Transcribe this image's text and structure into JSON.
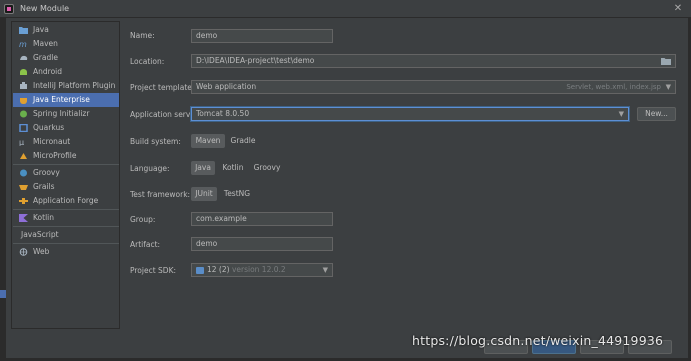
{
  "window": {
    "title": "New Module",
    "close_glyph": "✕"
  },
  "sidebar": {
    "group1": [
      {
        "label": "Java",
        "icon": "folder-icon",
        "color": "#6a9fd4"
      },
      {
        "label": "Maven",
        "icon": "maven-icon",
        "color": "#6a9fd4"
      },
      {
        "label": "Gradle",
        "icon": "gradle-icon",
        "color": "#a7b4c0"
      },
      {
        "label": "Android",
        "icon": "android-icon",
        "color": "#8bc34a"
      },
      {
        "label": "IntelliJ Platform Plugin",
        "icon": "plugin-icon",
        "color": "#a7b4c0"
      },
      {
        "label": "Java Enterprise",
        "icon": "java-enterprise-icon",
        "color": "#e0a030",
        "selected": true
      },
      {
        "label": "Spring Initializr",
        "icon": "spring-icon",
        "color": "#6ab04c"
      },
      {
        "label": "Quarkus",
        "icon": "quarkus-icon",
        "color": "#5d8fd4"
      },
      {
        "label": "Micronaut",
        "icon": "micronaut-icon",
        "color": "#a7b4c0"
      },
      {
        "label": "MicroProfile",
        "icon": "microprofile-icon",
        "color": "#e0a030"
      }
    ],
    "group2": [
      {
        "label": "Groovy",
        "icon": "groovy-icon",
        "color": "#4a90c2"
      },
      {
        "label": "Grails",
        "icon": "grails-icon",
        "color": "#e0a030"
      },
      {
        "label": "Application Forge",
        "icon": "forge-icon",
        "color": "#e0a030"
      }
    ],
    "group3": [
      {
        "label": "Kotlin",
        "icon": "kotlin-icon",
        "color": "#8e6fd8"
      }
    ],
    "group4": [
      {
        "label": "JavaScript",
        "icon": "",
        "color": ""
      }
    ],
    "group5": [
      {
        "label": "Web",
        "icon": "globe-icon",
        "color": "#a7b4c0"
      }
    ]
  },
  "form": {
    "name": {
      "label": "Name:",
      "value": "demo"
    },
    "location": {
      "label": "Location:",
      "value": "D:\\IDEA\\IDEA-project\\test\\demo",
      "browse_icon": "folder-browse-icon"
    },
    "template": {
      "label": "Project template:",
      "value": "Web application",
      "hint": "Servlet, web.xml, index.jsp"
    },
    "server": {
      "label": "Application server:",
      "value": "Tomcat 8.0.50",
      "new_button": "New..."
    },
    "build": {
      "label": "Build system:",
      "options": [
        "Maven",
        "Gradle"
      ],
      "selected": "Maven"
    },
    "language": {
      "label": "Language:",
      "options": [
        "Java",
        "Kotlin",
        "Groovy"
      ],
      "selected": "Java"
    },
    "test": {
      "label": "Test framework:",
      "options": [
        "JUnit",
        "TestNG"
      ],
      "selected": "JUnit"
    },
    "group": {
      "label": "Group:",
      "value": "com.example"
    },
    "artifact": {
      "label": "Artifact:",
      "value": "demo"
    },
    "sdk": {
      "label": "Project SDK:",
      "name": "12 (2)",
      "version": "version 12.0.2"
    }
  },
  "watermark": "https://blog.csdn.net/weixin_44919936",
  "colors": {
    "accent": "#4b6eaf",
    "focus": "#5d8fd4",
    "background": "#3c3f41"
  }
}
